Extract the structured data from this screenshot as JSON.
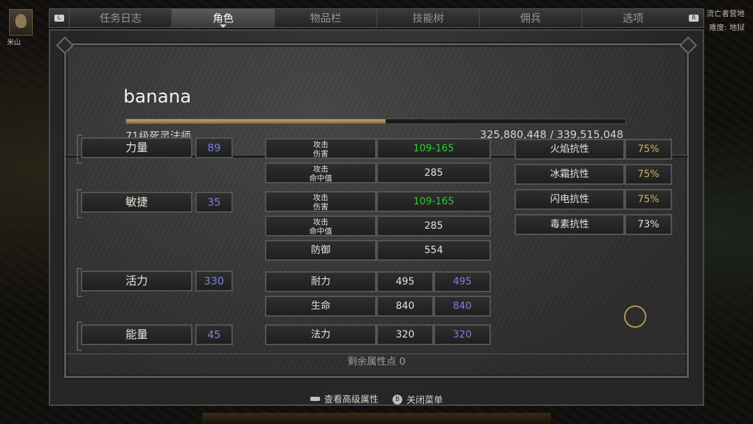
{
  "hud": {
    "player_name": "米山",
    "zone_name": "流亡者营地",
    "difficulty": "难度: 地狱",
    "left_bumper": "L",
    "right_bumper": "R"
  },
  "tabs": [
    "任务日志",
    "角色",
    "物品栏",
    "技能树",
    "佣兵",
    "选项"
  ],
  "active_tab": "角色",
  "character": {
    "name": "banana",
    "class_line": "71级死灵法师",
    "xp_text": "325,880,448 / 339,515,048",
    "xp_fraction": 0.52
  },
  "attributes": [
    {
      "label": "力量",
      "value": "89"
    },
    {
      "label": "敏捷",
      "value": "35"
    },
    {
      "label": "活力",
      "value": "330"
    },
    {
      "label": "能量",
      "value": "45"
    }
  ],
  "combat": {
    "damage1_l1": "攻击",
    "damage1_l2": "伤害",
    "damage1_value": "109-165",
    "ar1_l1": "攻击",
    "ar1_l2": "命中值",
    "ar1_value": "285",
    "damage2_l1": "攻击",
    "damage2_l2": "伤害",
    "damage2_value": "109-165",
    "ar2_l1": "攻击",
    "ar2_l2": "命中值",
    "ar2_value": "285",
    "defense_label": "防御",
    "defense_value": "554",
    "stamina_label": "耐力",
    "stamina_current": "495",
    "stamina_max": "495",
    "life_label": "生命",
    "life_current": "840",
    "life_max": "840",
    "mana_label": "法力",
    "mana_current": "320",
    "mana_max": "320"
  },
  "resistances": [
    {
      "label": "火焰抗性",
      "value": "75%"
    },
    {
      "label": "冰霜抗性",
      "value": "75%"
    },
    {
      "label": "闪电抗性",
      "value": "75%"
    },
    {
      "label": "毒素抗性",
      "value": "73%"
    }
  ],
  "remaining_points": "剩余属性点 0",
  "footer": {
    "advanced_stats": "查看高级属性",
    "close_button_glyph": "B",
    "close_menu": "关闭菜单"
  },
  "colors": {
    "damage_green": "#2ecc2e",
    "stat_blue": "#7f7fe6",
    "resist_gold": "#c9b45e"
  }
}
